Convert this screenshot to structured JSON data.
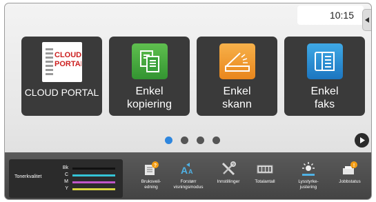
{
  "clock": {
    "time": "10:15"
  },
  "tiles": [
    {
      "label": "CLOUD PORTAL",
      "logo_line1": "CLOUD",
      "logo_line2": "PORTAL"
    },
    {
      "label": "Enkel\nkopiering"
    },
    {
      "label": "Enkel\nskann"
    },
    {
      "label": "Enkel\nfaks"
    }
  ],
  "pager": {
    "pages": 4,
    "current": 1
  },
  "toner": {
    "title": "Tonerkvalitet",
    "levels": [
      {
        "name": "Bk",
        "color": "#111111",
        "level": 1.0
      },
      {
        "name": "C",
        "color": "#34c4d6",
        "level": 1.0
      },
      {
        "name": "M",
        "color": "#c056c8",
        "level": 1.0
      },
      {
        "name": "Y",
        "color": "#d8d640",
        "level": 1.0
      }
    ]
  },
  "bottom_items": [
    {
      "label": "Bruksveil-\nedning",
      "icon": "guide-icon"
    },
    {
      "label": "Forstørr\nvisningsmodus",
      "icon": "magnify-text-icon"
    },
    {
      "label": "Innstillinger",
      "icon": "settings-tools-icon"
    },
    {
      "label": "Totalantall",
      "icon": "counter-icon"
    },
    {
      "label": "Lysstyrke-\njustering",
      "icon": "brightness-icon"
    },
    {
      "label": "Jobbstatus",
      "icon": "job-status-icon"
    }
  ],
  "colors": {
    "tile_bg": "#3a3a3a",
    "active_dot": "#2e86de",
    "bottom_bar": "#4d4d4d",
    "alert": "#f39c12"
  }
}
